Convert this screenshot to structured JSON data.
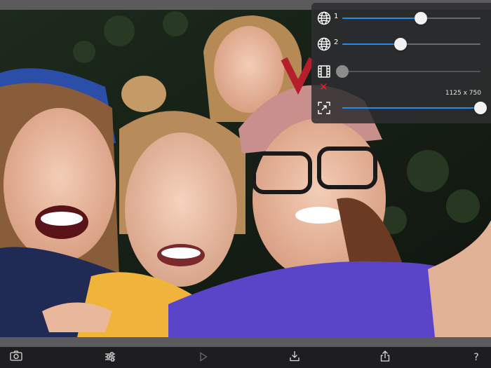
{
  "panel": {
    "rows": [
      {
        "label": "1",
        "icon": "globe-icon",
        "value": 0.57
      },
      {
        "label": "2",
        "icon": "globe-icon",
        "value": 0.42
      },
      {
        "label": "",
        "icon": "film-icon",
        "value": 0.0,
        "disabled": true
      },
      {
        "label": "",
        "icon": "resize-icon",
        "value": 1.0
      }
    ],
    "size_label": "1125 x 750"
  },
  "toolbar": {
    "help_label": "?"
  },
  "colors": {
    "accent": "#1c8df5",
    "close": "#e5222a",
    "toolbar_bg": "#1e1e20"
  }
}
